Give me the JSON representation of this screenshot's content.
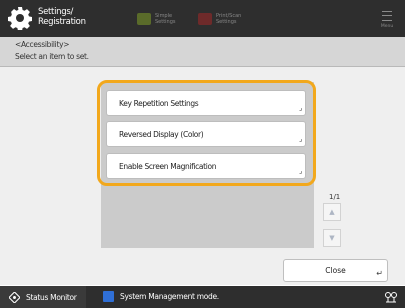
{
  "topbar": {
    "title_line1": "Settings/",
    "title_line2": "Registration",
    "shortcut1_label": "Simple Settings",
    "shortcut2_label": "Print/Scan Settings",
    "menu_label": "Menu",
    "icons": {
      "settings": "gear-icon",
      "menu": "hamburger-icon"
    }
  },
  "header": {
    "breadcrumb": "<Accessibility>",
    "instruction": "Select an item to set."
  },
  "items": [
    {
      "label": "Key Repetition Settings"
    },
    {
      "label": "Reversed Display (Color)"
    },
    {
      "label": "Enable Screen Magnification"
    }
  ],
  "pagination": {
    "text": "1/1"
  },
  "buttons": {
    "close": "Close"
  },
  "bottombar": {
    "status_monitor": "Status Monitor",
    "system_message": "System Management mode."
  },
  "colors": {
    "highlight": "#f2a81c",
    "topbar": "#2e2e2e",
    "accent_blue": "#2f6fd6"
  }
}
